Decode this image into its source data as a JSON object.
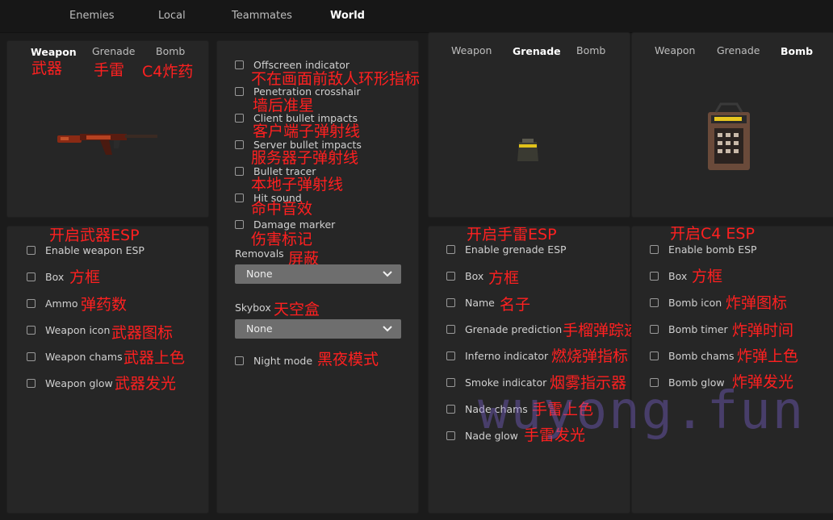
{
  "top_tabs": [
    "Enemies",
    "Local",
    "Teammates",
    "World"
  ],
  "panel1": {
    "subtabs": [
      "Weapon",
      "Grenade",
      "Bomb"
    ],
    "annotations": [
      "武器",
      "手雷",
      "C4炸药"
    ]
  },
  "panel_weapon_options": {
    "header_annotation": "开启武器ESP",
    "items": [
      {
        "label": "Enable weapon ESP",
        "annotation": ""
      },
      {
        "label": "Box",
        "annotation": "方框"
      },
      {
        "label": "Ammo",
        "annotation": "弹药数"
      },
      {
        "label": "Weapon icon",
        "annotation": "武器图标"
      },
      {
        "label": "Weapon chams",
        "annotation": "武器上色"
      },
      {
        "label": "Weapon glow",
        "annotation": "武器发光"
      }
    ]
  },
  "panel_world": {
    "items": [
      {
        "label": "Offscreen indicator",
        "annotation": "不在画面前敌人环形指标"
      },
      {
        "label": "Penetration crosshair",
        "annotation": "墙后准星"
      },
      {
        "label": "Client bullet impacts",
        "annotation": "客户端子弹射线"
      },
      {
        "label": "Server bullet impacts",
        "annotation": "服务器子弹射线"
      },
      {
        "label": "Bullet tracer",
        "annotation": "本地子弹射线"
      },
      {
        "label": "Hit sound",
        "annotation": "命中音效"
      },
      {
        "label": "Damage marker",
        "annotation": "伤害标记"
      }
    ],
    "removals": {
      "label": "Removals",
      "annotation": "屏蔽",
      "value": "None"
    },
    "skybox": {
      "label": "Skybox",
      "annotation": "天空盒",
      "value": "None"
    },
    "night_mode": {
      "label": "Night mode",
      "annotation": "黑夜模式"
    }
  },
  "panel3": {
    "subtabs": [
      "Weapon",
      "Grenade",
      "Bomb"
    ]
  },
  "panel_grenade_options": {
    "header_annotation": "开启手雷ESP",
    "items": [
      {
        "label": "Enable grenade ESP",
        "annotation": ""
      },
      {
        "label": "Box",
        "annotation": "方框"
      },
      {
        "label": "Name",
        "annotation": "名子"
      },
      {
        "label": "Grenade prediction",
        "annotation": "手榴弹踪迹"
      },
      {
        "label": "Inferno indicator",
        "annotation": "燃烧弹指标"
      },
      {
        "label": "Smoke indicator",
        "annotation": "烟雾指示器"
      },
      {
        "label": "Nade chams",
        "annotation": "手雷上色"
      },
      {
        "label": "Nade glow",
        "annotation": "手雷发光"
      }
    ]
  },
  "panel4": {
    "subtabs": [
      "Weapon",
      "Grenade",
      "Bomb"
    ]
  },
  "panel_bomb_options": {
    "header_annotation": "开启C4 ESP",
    "items": [
      {
        "label": "Enable bomb ESP",
        "annotation": ""
      },
      {
        "label": "Box",
        "annotation": "方框"
      },
      {
        "label": "Bomb icon",
        "annotation": "炸弹图标"
      },
      {
        "label": "Bomb timer",
        "annotation": "炸弹时间"
      },
      {
        "label": "Bomb chams",
        "annotation": "炸弹上色"
      },
      {
        "label": "Bomb glow",
        "annotation": "炸弹发光"
      }
    ]
  },
  "watermark": "wuyong.fun",
  "colors": {
    "annotation": "#ff2020",
    "select_bg": "#6e6e6e",
    "panel_bg": "#262626"
  },
  "icons": [
    "rifle-icon",
    "grenade-icon",
    "c4-bomb-icon",
    "chevron-down-icon"
  ]
}
